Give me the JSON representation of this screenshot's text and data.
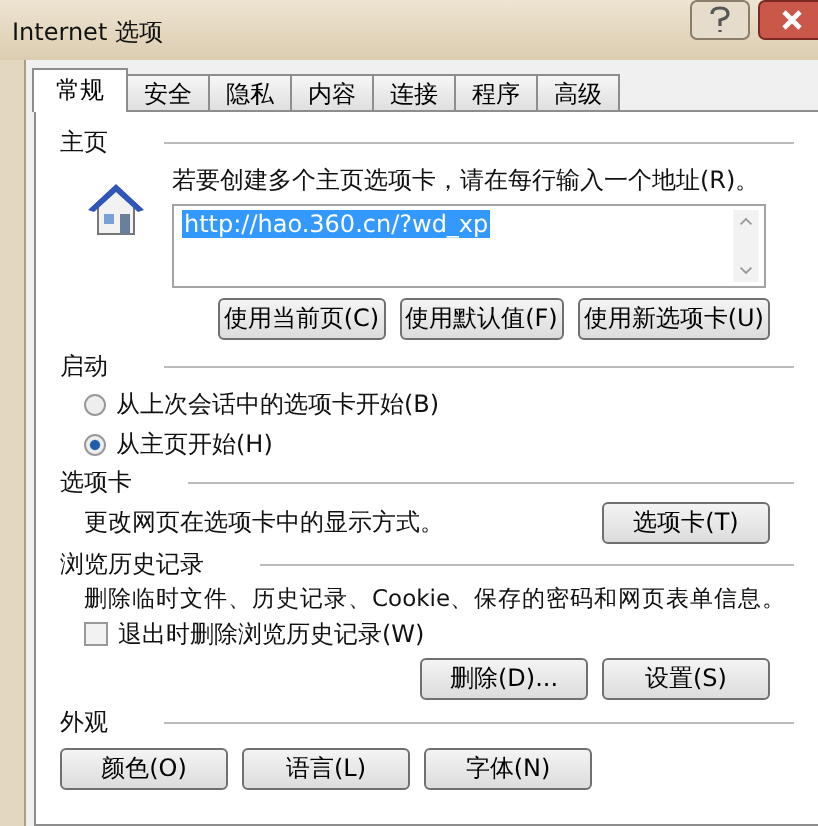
{
  "window": {
    "title": "Internet 选项"
  },
  "tabs": [
    {
      "label": "常规",
      "selected": true
    },
    {
      "label": "安全",
      "selected": false
    },
    {
      "label": "隐私",
      "selected": false
    },
    {
      "label": "内容",
      "selected": false
    },
    {
      "label": "连接",
      "selected": false
    },
    {
      "label": "程序",
      "selected": false
    },
    {
      "label": "高级",
      "selected": false
    }
  ],
  "home_page": {
    "title": "主页",
    "description": "若要创建多个主页选项卡，请在每行输入一个地址(R)。",
    "url_field": {
      "value": "http://hao.360.cn/?wd_xp",
      "selected": true
    },
    "buttons": [
      "使用当前页(C)",
      "使用默认值(F)",
      "使用新选项卡(U)"
    ]
  },
  "startup": {
    "title": "启动",
    "options": [
      {
        "label": "从上次会话中的选项卡开始(B)",
        "selected": false
      },
      {
        "label": "从主页开始(H)",
        "selected": true
      }
    ]
  },
  "tabs_section": {
    "title": "选项卡",
    "description": "更改网页在选项卡中的显示方式。",
    "button": "选项卡(T)"
  },
  "history": {
    "title": "浏览历史记录",
    "description": "删除临时文件、历史记录、Cookie、保存的密码和网页表单信息。",
    "checkbox": {
      "label": "退出时删除浏览历史记录(W)",
      "checked": false
    },
    "buttons": [
      "删除(D)...",
      "设置(S)"
    ]
  },
  "appearance": {
    "title": "外观",
    "buttons": [
      "颜色(O)",
      "语言(L)",
      "字体(N)"
    ]
  }
}
